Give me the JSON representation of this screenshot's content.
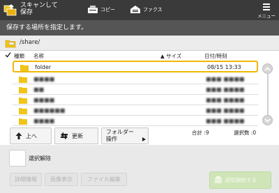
{
  "header": {
    "title_line1": "スキャンして",
    "title_line2": "保存",
    "tabs": [
      {
        "label": "コピー",
        "icon": "copy-icon"
      },
      {
        "label": "ファクス",
        "icon": "fax-icon"
      }
    ],
    "menu_label": "メニュー"
  },
  "instruction": "保存する場所を指定します。",
  "path": "/share/",
  "columns": {
    "type": "種類",
    "name": "名称",
    "size": "▲ サイズ",
    "datetime": "日付/時刻"
  },
  "rows": [
    {
      "name": "folder",
      "datetime": "08/15 13:33",
      "selected": true
    },
    {
      "name": "■■■■",
      "datetime": "■■■ ■■■■",
      "selected": false
    },
    {
      "name": "■■",
      "datetime": "■■■ ■■■■",
      "selected": false
    },
    {
      "name": "■■■■",
      "datetime": "■■■ ■■■■",
      "selected": false
    },
    {
      "name": "■■■■■■",
      "datetime": "■■■ ■■■■",
      "selected": false
    },
    {
      "name": "■■■■",
      "datetime": "■■■ ■■■■",
      "selected": false
    }
  ],
  "actions": {
    "up": "上へ",
    "refresh": "更新",
    "folder_ops_line1": "フォルダー",
    "folder_ops_line2": "操作",
    "total": "合計 :9",
    "selected_count": "選択数 :0"
  },
  "bottom": {
    "deselect": "選択解除",
    "details": "詳細情報",
    "preview": "画像表示",
    "file_edit": "ファイル編集",
    "start": "読取開始する"
  },
  "colors": {
    "header_bg": "#3a3a3a",
    "instruction_bg": "#555555",
    "selection_border": "#f2b705",
    "folder_yellow": "#f0c419",
    "start_green": "#cfe5b8"
  }
}
